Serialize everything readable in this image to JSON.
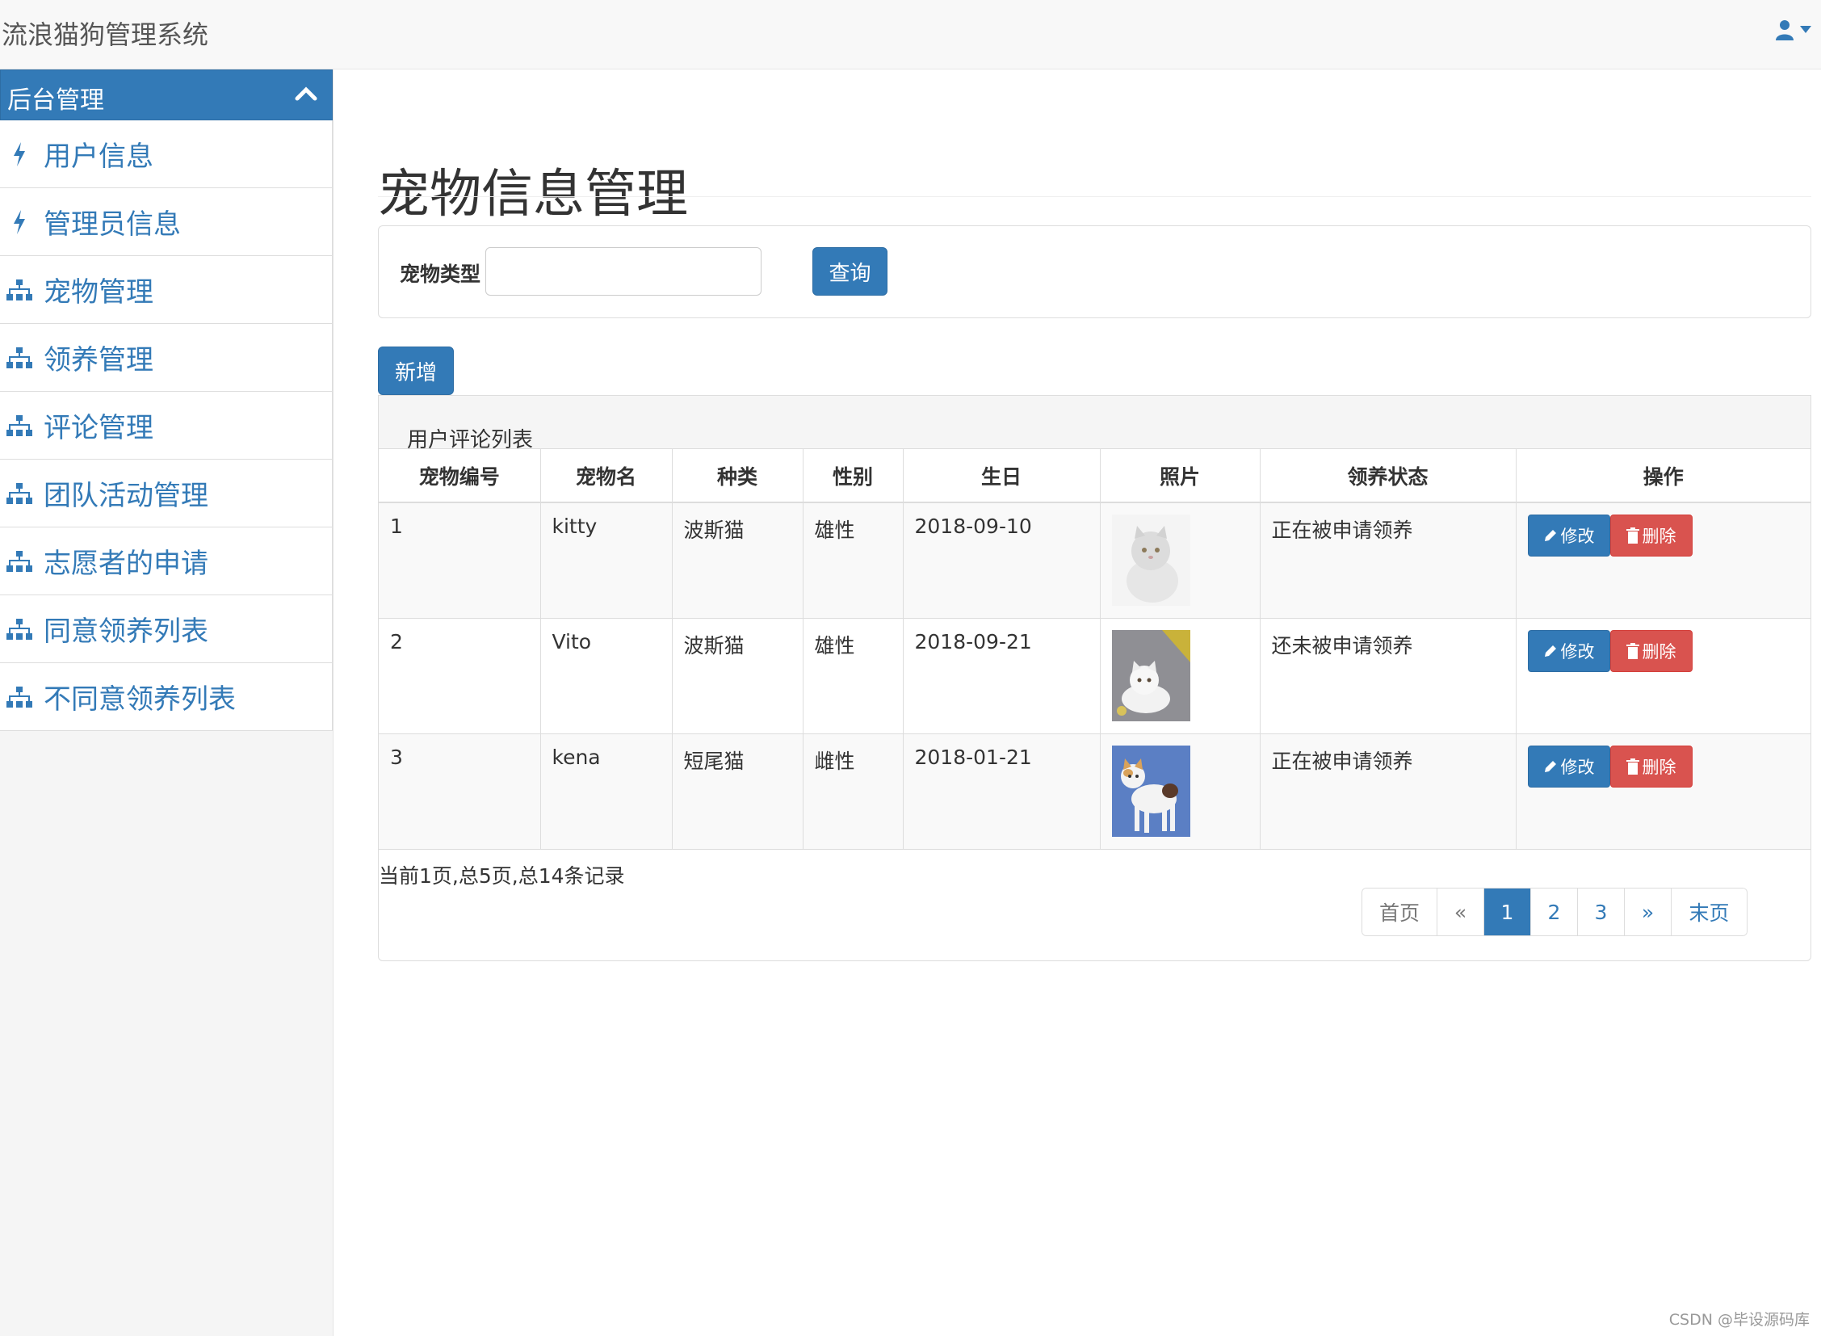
{
  "app": {
    "title": "流浪猫狗管理系统"
  },
  "sidebar": {
    "panel_title": "后台管理",
    "items": [
      {
        "label": "用户信息",
        "icon": "bolt-icon"
      },
      {
        "label": "管理员信息",
        "icon": "bolt-icon"
      },
      {
        "label": "宠物管理",
        "icon": "sitemap-icon"
      },
      {
        "label": "领养管理",
        "icon": "sitemap-icon"
      },
      {
        "label": "评论管理",
        "icon": "sitemap-icon"
      },
      {
        "label": "团队活动管理",
        "icon": "sitemap-icon"
      },
      {
        "label": "志愿者的申请",
        "icon": "sitemap-icon"
      },
      {
        "label": "同意领养列表",
        "icon": "sitemap-icon"
      },
      {
        "label": "不同意领养列表",
        "icon": "sitemap-icon"
      }
    ]
  },
  "main": {
    "page_title": "宠物信息管理",
    "search": {
      "label": "宠物类型",
      "value": "",
      "button": "查询"
    },
    "add_button": "新增",
    "table": {
      "caption": "用户评论列表",
      "columns": [
        "宠物编号",
        "宠物名",
        "种类",
        "性别",
        "生日",
        "照片",
        "领养状态",
        "操作"
      ],
      "rows": [
        {
          "id": "1",
          "name": "kitty",
          "breed": "波斯猫",
          "sex": "雄性",
          "birthday": "2018-09-10",
          "photo": "white-persian-cat-photo",
          "status": "正在被申请领养"
        },
        {
          "id": "2",
          "name": "Vito",
          "breed": "波斯猫",
          "sex": "雄性",
          "birthday": "2018-09-21",
          "photo": "white-kitten-photo",
          "status": "还未被申请领养"
        },
        {
          "id": "3",
          "name": "kena",
          "breed": "短尾猫",
          "sex": "雌性",
          "birthday": "2018-01-21",
          "photo": "calico-bobtail-cat-photo",
          "status": "正在被申请领养"
        }
      ],
      "edit_label": "修改",
      "delete_label": "删除"
    },
    "summary": "当前1页,总5页,总14条记录",
    "pagination": [
      "首页",
      "«",
      "1",
      "2",
      "3",
      "»",
      "末页"
    ],
    "current_page": "1"
  },
  "watermark": "CSDN @毕设源码库",
  "colors": {
    "primary": "#337ab7",
    "danger": "#d9534f",
    "topbar": "#f8f8f8"
  }
}
